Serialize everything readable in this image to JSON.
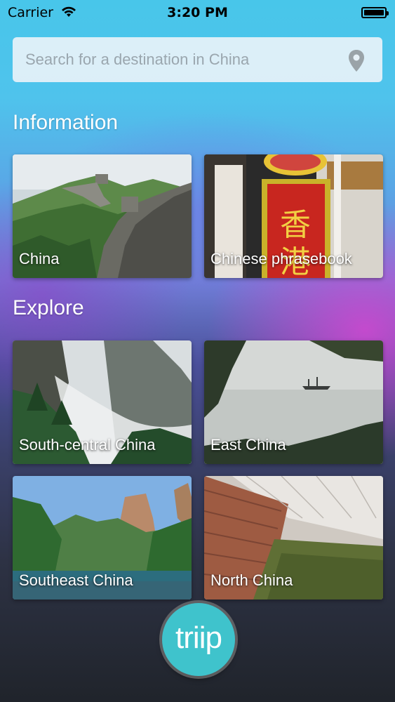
{
  "status_bar": {
    "carrier": "Carrier",
    "time": "3:20 PM"
  },
  "search": {
    "placeholder": "Search for a destination in China",
    "icon": "location-pin-icon"
  },
  "sections": {
    "information": {
      "title": "Information",
      "cards": [
        {
          "label": "China",
          "image": "great-wall-photo"
        },
        {
          "label": "Chinese phrasebook",
          "image": "chinese-shop-sign-photo"
        }
      ]
    },
    "explore": {
      "title": "Explore",
      "cards": [
        {
          "label": "South-central China",
          "image": "misty-mountains-photo"
        },
        {
          "label": "East China",
          "image": "hazy-lake-boat-photo"
        },
        {
          "label": "Southeast China",
          "image": "river-cliffs-photo"
        },
        {
          "label": "North China",
          "image": "greenhouse-photo"
        }
      ]
    }
  },
  "logo": {
    "text": "triip"
  },
  "colors": {
    "logo_bg": "#3fc3cc",
    "sky_top": "#48c6ea",
    "bottom_dark": "#20242b"
  }
}
